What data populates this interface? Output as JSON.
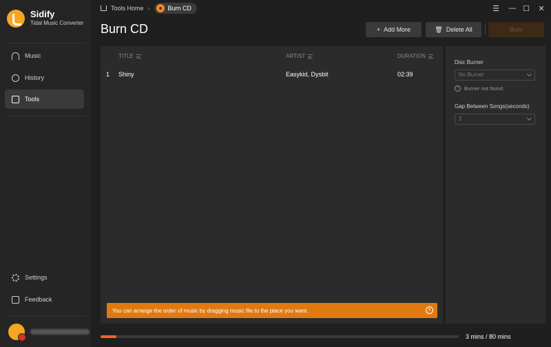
{
  "brand": {
    "name": "Sidify",
    "subtitle": "Tidal Music Converter"
  },
  "sidebar": {
    "items": [
      {
        "label": "Music",
        "icon": "headphones-icon"
      },
      {
        "label": "History",
        "icon": "clock-icon"
      },
      {
        "label": "Tools",
        "icon": "toolbox-icon",
        "active": true
      }
    ],
    "bottom_items": [
      {
        "label": "Settings",
        "icon": "gear-icon"
      },
      {
        "label": "Feedback",
        "icon": "mail-icon"
      }
    ],
    "user": {
      "name": ""
    }
  },
  "breadcrumb": {
    "home": "Tools Home",
    "separator": "›",
    "current": "Burn CD"
  },
  "window": {
    "menu": "☰",
    "minimize": "—",
    "maximize": "☐",
    "close": "✕"
  },
  "page": {
    "title": "Burn CD"
  },
  "toolbar": {
    "add_label": "Add More",
    "delete_label": "Delete All",
    "burn_label": "Burn"
  },
  "table": {
    "columns": [
      "TITLE",
      "ARTIST",
      "DURATION"
    ],
    "rows": [
      {
        "index": "1",
        "title": "Shiny",
        "artist": "Easykid, Dysbit",
        "duration": "02:39"
      }
    ]
  },
  "tip": {
    "text": "You can arrange the order of music by dragging music file to the place you want."
  },
  "settings": {
    "disc_burner_label": "Disc Burner",
    "disc_burner_value": "No Burner",
    "burner_hint": "Burner not found.",
    "gap_label": "Gap Between Songs(seconds)",
    "gap_value": "2"
  },
  "footer": {
    "capacity_text": "3 mins / 80 mins",
    "progress_percent": 4.5
  },
  "colors": {
    "accent": "#f58a1f",
    "tip_bg": "#e07a10",
    "progress": "#f5631f"
  }
}
